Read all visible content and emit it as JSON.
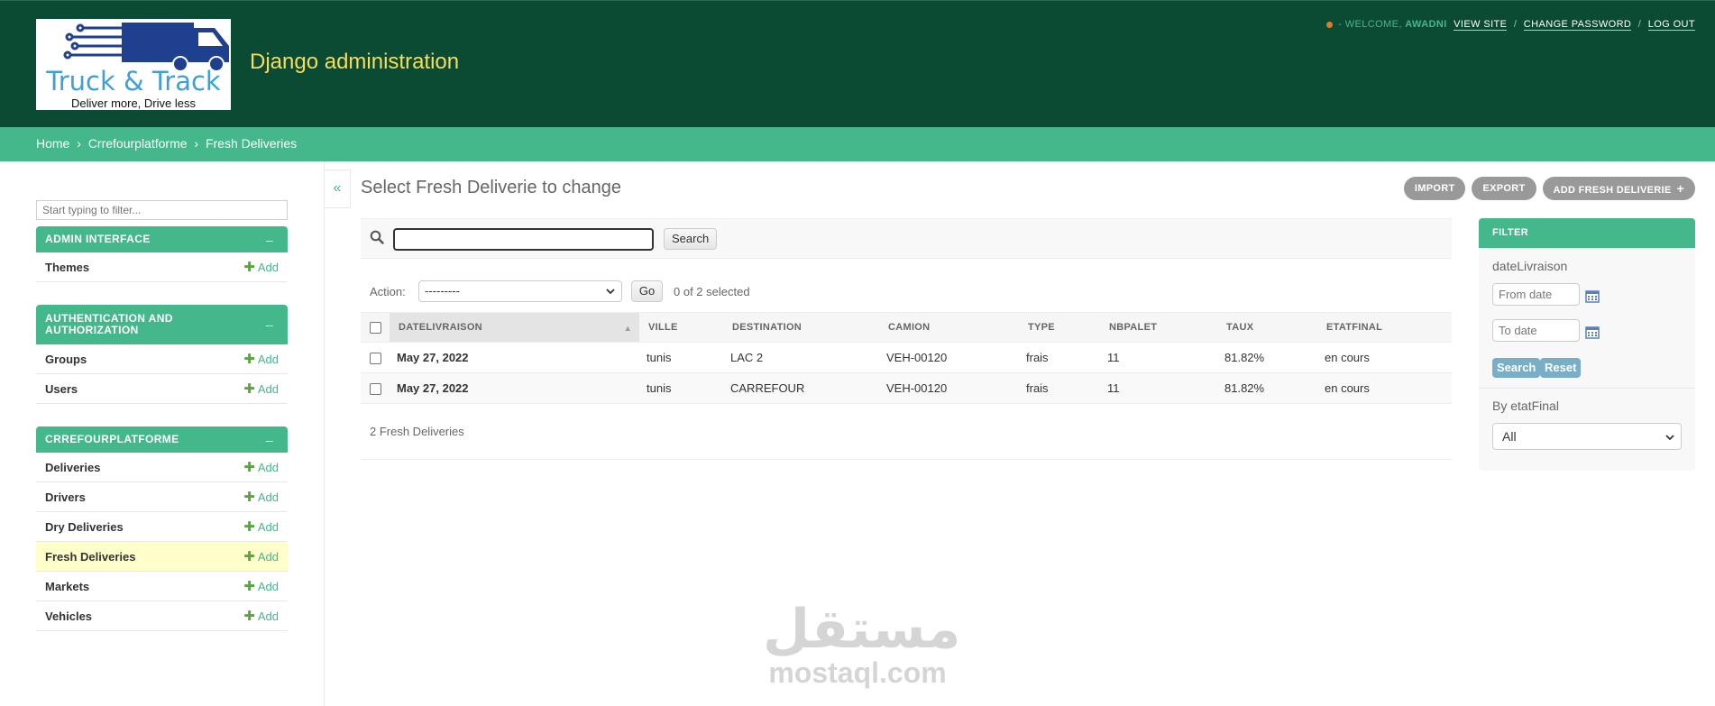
{
  "header": {
    "logo": {
      "title": "Truck & Track",
      "tagline": "Deliver more, Drive less"
    },
    "site_title": "Django administration",
    "user_tools": {
      "welcome": "- Welcome,",
      "username": "AWADNI",
      "view_site": "View site",
      "change_password": "Change password",
      "log_out": "Log out",
      "separator": "/"
    }
  },
  "breadcrumbs": {
    "items": [
      "Home",
      "Crrefourplatforme",
      "Fresh Deliveries"
    ],
    "separator": "›"
  },
  "sidebar": {
    "filter_placeholder": "Start typing to filter...",
    "collapse_symbol": "–",
    "add_label": "Add",
    "modules": [
      {
        "caption": "Admin Interface",
        "models": [
          "Themes"
        ]
      },
      {
        "caption": "Authentication and Authorization",
        "models": [
          "Groups",
          "Users"
        ]
      },
      {
        "caption": "Crrefourplatforme",
        "models": [
          "Deliveries",
          "Drivers",
          "Dry Deliveries",
          "Fresh Deliveries",
          "Markets",
          "Vehicles"
        ]
      }
    ],
    "active_model": "Fresh Deliveries",
    "toggle_symbol": "«"
  },
  "content": {
    "title": "Select Fresh Deliverie to change",
    "object_tools": {
      "import": "Import",
      "export": "Export",
      "add": "Add Fresh Deliverie",
      "add_symbol": "+"
    },
    "search": {
      "value": "",
      "button": "Search"
    },
    "actions": {
      "label": "Action:",
      "selected": "---------",
      "go": "Go",
      "count": "0 of 2 selected"
    },
    "table": {
      "columns": [
        "dateLivraison",
        "ville",
        "destination",
        "camion",
        "type",
        "nbPalet",
        "taux",
        "etatFinal"
      ],
      "sorted_column": "dateLivraison",
      "sort_symbol": "▲",
      "rows": [
        [
          "May 27, 2022",
          "tunis",
          "LAC 2",
          "VEH-00120",
          "frais",
          "11",
          "81.82%",
          "en cours"
        ],
        [
          "May 27, 2022",
          "tunis",
          "CARREFOUR",
          "VEH-00120",
          "frais",
          "11",
          "81.82%",
          "en cours"
        ]
      ]
    },
    "paginator": "2 Fresh Deliveries"
  },
  "filter": {
    "title": "Filter",
    "date_field": "dateLivraison",
    "from_placeholder": "From date",
    "to_placeholder": "To date",
    "search_button": "Search",
    "reset_button": "Reset",
    "etat_label": "By etatFinal",
    "etat_selected": "All"
  },
  "watermark": {
    "arabic": "مستقل",
    "latin": "mostaql.com"
  },
  "colors": {
    "header_bg": "#0c4b33",
    "accent": "#44b78b",
    "site_title": "#f5dd5d",
    "active_row": "#ffffcc",
    "object_tool": "#999999",
    "filter_button": "#79aec8"
  }
}
